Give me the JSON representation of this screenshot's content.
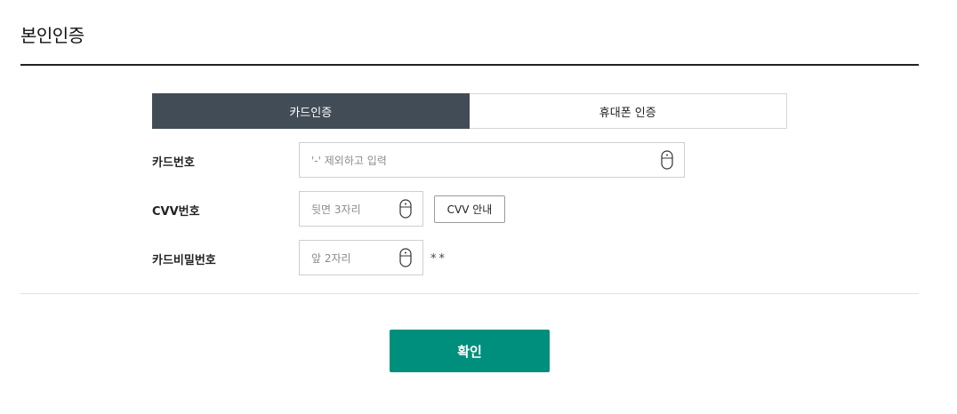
{
  "page": {
    "title": "본인인증"
  },
  "tabs": [
    {
      "label": "카드인증",
      "active": true
    },
    {
      "label": "휴대폰 인증",
      "active": false
    }
  ],
  "form": {
    "card_number": {
      "label": "카드번호",
      "placeholder": "'-' 제외하고 입력"
    },
    "cvv": {
      "label": "CVV번호",
      "placeholder": "뒷면 3자리",
      "guide_button": "CVV 안내"
    },
    "card_password": {
      "label": "카드비밀번호",
      "placeholder": "앞 2자리",
      "mask": "**"
    }
  },
  "actions": {
    "confirm_label": "확인"
  },
  "colors": {
    "active_tab": "#424c57",
    "confirm": "#008f7c"
  },
  "icons": {
    "input_keypad": "mouse-icon"
  }
}
